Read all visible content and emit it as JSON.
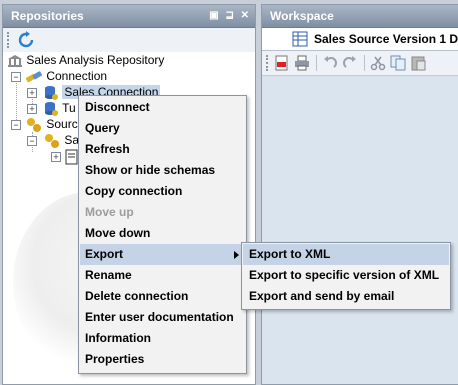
{
  "repositories": {
    "title": "Repositories",
    "controls": "▣ ⊒ ✕",
    "tree": {
      "root": "Sales Analysis Repository",
      "connection": "Connection",
      "sales_connection": "Sales Connection",
      "tu": "Tu",
      "source": "Sourc",
      "sa": "Sa"
    }
  },
  "workspace": {
    "title": "Workspace",
    "tab_label": "Sales Source Version 1 D"
  },
  "context_menu": {
    "items": [
      {
        "label": "Disconnect"
      },
      {
        "label": "Query"
      },
      {
        "label": "Refresh"
      },
      {
        "label": "Show or hide schemas"
      },
      {
        "label": "Copy connection"
      },
      {
        "label": "Move up",
        "disabled": true
      },
      {
        "label": "Move down"
      },
      {
        "label": "Export",
        "submenu": true
      },
      {
        "label": "Rename"
      },
      {
        "label": "Delete connection"
      },
      {
        "label": "Enter user documentation"
      },
      {
        "label": "Information"
      },
      {
        "label": "Properties"
      }
    ]
  },
  "export_submenu": {
    "items": [
      {
        "label": "Export to XML"
      },
      {
        "label": "Export to specific version of XML"
      },
      {
        "label": "Export and send by email"
      }
    ]
  }
}
